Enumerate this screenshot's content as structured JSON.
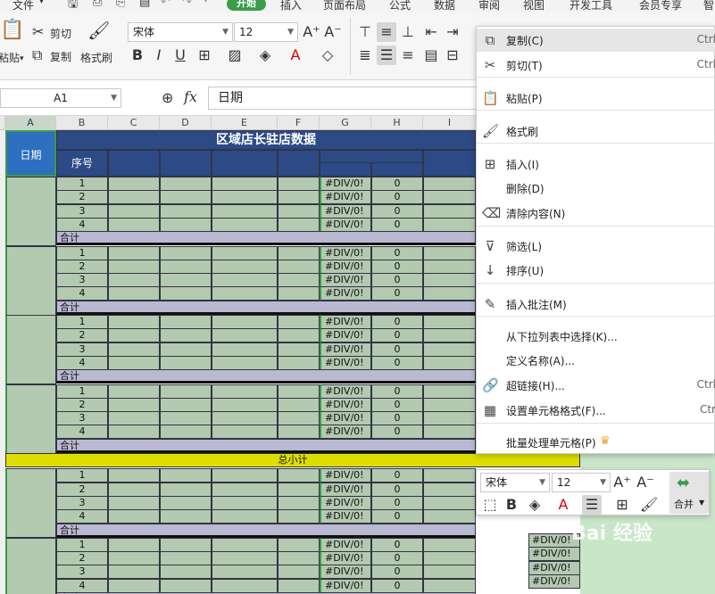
{
  "menu": {
    "file": "文件",
    "tabs": [
      "开始",
      "插入",
      "页面布局",
      "公式",
      "数据",
      "审阅",
      "视图",
      "开发工具",
      "会员专享",
      "智"
    ]
  },
  "ribbon": {
    "paste": "粘贴",
    "cut": "剪切",
    "copy": "复制",
    "format_painter": "格式刷",
    "font_name": "宋体",
    "font_size": "12"
  },
  "formula_bar": {
    "name_box": "A1",
    "fx": "fx",
    "content": "日期"
  },
  "columns": [
    "A",
    "B",
    "C",
    "D",
    "E",
    "F",
    "G",
    "H",
    "I"
  ],
  "table": {
    "title": "区域店长驻店数据",
    "date_header": "日期",
    "seq_header": "序号",
    "subtotal_label": "合计",
    "total_label": "总小计",
    "row_numbers": [
      "1",
      "2",
      "3",
      "4"
    ],
    "div_error": "#DIV/0!",
    "zero": "0"
  },
  "context_menu": {
    "items": [
      {
        "icon": "copy-icon",
        "glyph": "⧉",
        "label": "复制(C)",
        "shortcut": "Ctrl"
      },
      {
        "icon": "cut-icon",
        "glyph": "✂",
        "label": "剪切(T)",
        "shortcut": "Ctrl"
      },
      {
        "icon": "paste-icon",
        "glyph": "📋",
        "label": "粘贴(P)",
        "shortcut": ""
      },
      {
        "icon": "format-painter-icon",
        "glyph": "🖌",
        "label": "格式刷",
        "shortcut": ""
      },
      {
        "icon": "insert-icon",
        "glyph": "⊞",
        "label": "插入(I)",
        "shortcut": ""
      },
      {
        "icon": "",
        "glyph": "",
        "label": "删除(D)",
        "shortcut": ""
      },
      {
        "icon": "eraser-icon",
        "glyph": "⌫",
        "label": "清除内容(N)",
        "shortcut": ""
      },
      {
        "icon": "filter-icon",
        "glyph": "⊽",
        "label": "筛选(L)",
        "shortcut": ""
      },
      {
        "icon": "sort-icon",
        "glyph": "↓",
        "label": "排序(U)",
        "shortcut": ""
      },
      {
        "icon": "comment-icon",
        "glyph": "✎",
        "label": "插入批注(M)",
        "shortcut": ""
      },
      {
        "icon": "",
        "glyph": "",
        "label": "从下拉列表中选择(K)...",
        "shortcut": ""
      },
      {
        "icon": "",
        "glyph": "",
        "label": "定义名称(A)...",
        "shortcut": ""
      },
      {
        "icon": "link-icon",
        "glyph": "🔗",
        "label": "超链接(H)...",
        "shortcut": "Ctrl"
      },
      {
        "icon": "cell-format-icon",
        "glyph": "▦",
        "label": "设置单元格格式(F)...",
        "shortcut": "Ctr"
      },
      {
        "icon": "",
        "glyph": "",
        "label": "批量处理单元格(P)",
        "shortcut": ""
      }
    ]
  },
  "mini_toolbar": {
    "font_name": "宋体",
    "font_size": "12",
    "merge": "合并"
  },
  "watermark": "Bai 经验",
  "colors": {
    "header_blue": "#2b4a86",
    "date_blue": "#2e6fbf",
    "data_green": "#b3c9b0",
    "subtotal_purple": "#b9b9d2",
    "total_yellow": "#dede00",
    "accent_green": "#3a9d4a"
  }
}
